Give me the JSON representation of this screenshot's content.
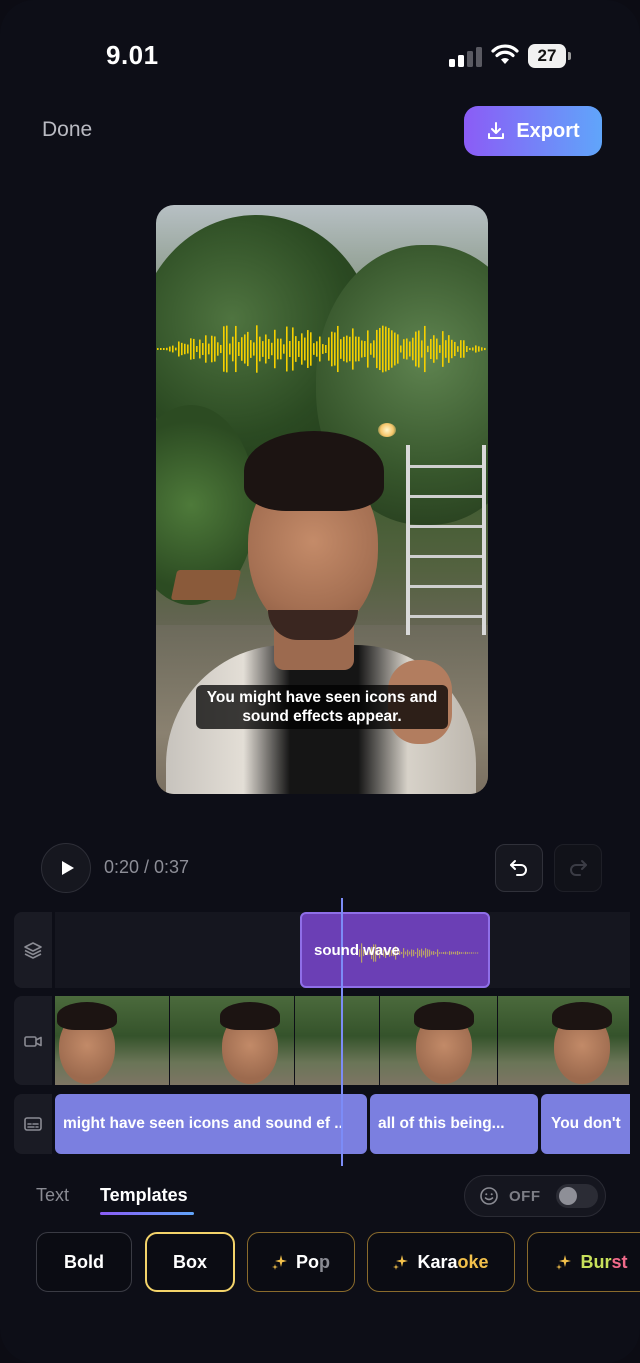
{
  "status_bar": {
    "time": "9.01",
    "battery": "27"
  },
  "header": {
    "done_label": "Done",
    "export_label": "Export"
  },
  "preview": {
    "caption": "You might have seen icons and sound effects appear."
  },
  "playback": {
    "time": "0:20 / 0:37"
  },
  "timeline": {
    "effects_clip_label": "sound wave",
    "caption_clips": [
      "might have seen icons and sound ef ..",
      "all of this being...",
      "You don't"
    ]
  },
  "panel": {
    "tabs": [
      "Text",
      "Templates"
    ],
    "active_tab": "Templates",
    "toggle_label": "OFF",
    "templates": [
      {
        "label": "Bold"
      },
      {
        "label": "Box"
      },
      {
        "label": "Pop"
      },
      {
        "label": "Karaoke"
      },
      {
        "label": "Burst"
      }
    ]
  },
  "colors": {
    "accent_gradient_start": "#8b5cf6",
    "accent_gradient_end": "#60a5fa",
    "effects_clip": "#6b3fb5",
    "caption_clip": "#7b7fe0",
    "selected_template_border": "#f3d36a",
    "waveform": "#f5d000"
  }
}
